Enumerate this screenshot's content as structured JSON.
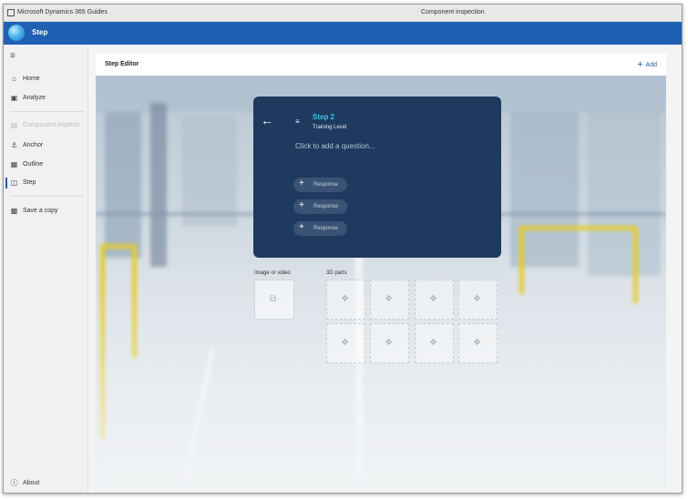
{
  "window": {
    "app_title": "Microsoft Dynamics 365 Guides",
    "document_title": "Component inspection"
  },
  "appbar": {
    "mode_title": "Step"
  },
  "sidebar": {
    "items": [
      {
        "label": "Home",
        "icon": "home-icon",
        "state": "normal"
      },
      {
        "label": "Analyze",
        "icon": "analyze-icon",
        "state": "normal"
      },
      {
        "label": "Component inspecti...",
        "icon": "guide-icon",
        "state": "disabled"
      },
      {
        "label": "Anchor",
        "icon": "anchor-icon",
        "state": "normal"
      },
      {
        "label": "Outline",
        "icon": "outline-icon",
        "state": "normal"
      },
      {
        "label": "Step",
        "icon": "step-icon",
        "state": "active"
      },
      {
        "label": "Save a copy",
        "icon": "save-icon",
        "state": "normal"
      }
    ],
    "about_label": "About"
  },
  "editor": {
    "header_title": "Step Editor",
    "add_label": "Add"
  },
  "step_card": {
    "step_number": "Step 2",
    "step_subtitle": "Training Level",
    "question_placeholder": "Click to add a question...",
    "responses": [
      "Response",
      "Response",
      "Response"
    ]
  },
  "media": {
    "image_video_label": "Image or video",
    "parts_label": "3D parts"
  },
  "colors": {
    "appbar": "#1f5fb4",
    "card": "#1e3a5f",
    "step_accent": "#36c5e8"
  }
}
